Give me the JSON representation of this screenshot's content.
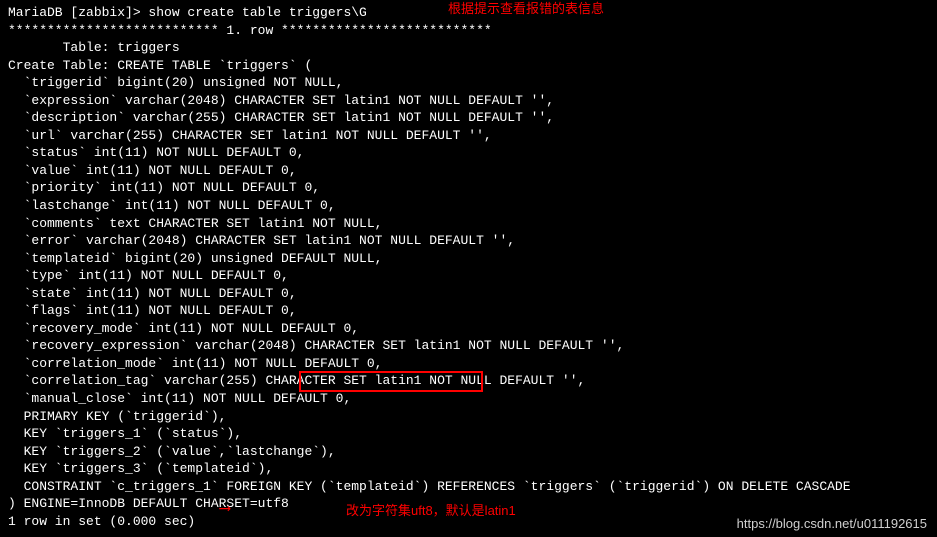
{
  "terminal": {
    "prompt": "MariaDB [zabbix]> show create table triggers\\G",
    "row_sep": "*************************** 1. row ***************************",
    "lines": [
      "       Table: triggers",
      "Create Table: CREATE TABLE `triggers` (",
      "  `triggerid` bigint(20) unsigned NOT NULL,",
      "  `expression` varchar(2048) CHARACTER SET latin1 NOT NULL DEFAULT '',",
      "  `description` varchar(255) CHARACTER SET latin1 NOT NULL DEFAULT '',",
      "  `url` varchar(255) CHARACTER SET latin1 NOT NULL DEFAULT '',",
      "  `status` int(11) NOT NULL DEFAULT 0,",
      "  `value` int(11) NOT NULL DEFAULT 0,",
      "  `priority` int(11) NOT NULL DEFAULT 0,",
      "  `lastchange` int(11) NOT NULL DEFAULT 0,",
      "  `comments` text CHARACTER SET latin1 NOT NULL,",
      "  `error` varchar(2048) CHARACTER SET latin1 NOT NULL DEFAULT '',",
      "  `templateid` bigint(20) unsigned DEFAULT NULL,",
      "  `type` int(11) NOT NULL DEFAULT 0,",
      "  `state` int(11) NOT NULL DEFAULT 0,",
      "  `flags` int(11) NOT NULL DEFAULT 0,",
      "  `recovery_mode` int(11) NOT NULL DEFAULT 0,",
      "  `recovery_expression` varchar(2048) CHARACTER SET latin1 NOT NULL DEFAULT '',",
      "  `correlation_mode` int(11) NOT NULL DEFAULT 0,",
      "  `correlation_tag` varchar(255) CHARACTER SET latin1 NOT NULL DEFAULT '',",
      "  `manual_close` int(11) NOT NULL DEFAULT 0,",
      "  PRIMARY KEY (`triggerid`),",
      "  KEY `triggers_1` (`status`),",
      "  KEY `triggers_2` (`value`,`lastchange`),",
      "  KEY `triggers_3` (`templateid`),",
      "  CONSTRAINT `c_triggers_1` FOREIGN KEY (`templateid`) REFERENCES `triggers` (`triggerid`) ON DELETE CASCADE",
      ") ENGINE=InnoDB DEFAULT CHARSET=utf8",
      "1 row in set (0.000 sec)"
    ]
  },
  "annotations": {
    "a1": "根据提示查看报错的表信息",
    "a2": "改为字符集uft8，默认是latin1"
  },
  "watermark": "https://blog.csdn.net/u011192615"
}
